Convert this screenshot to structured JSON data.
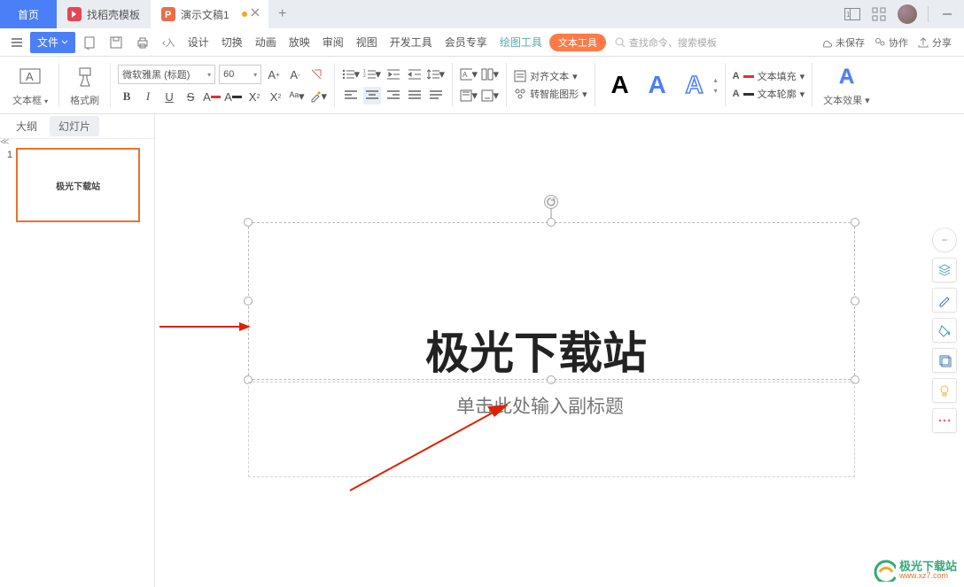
{
  "tabs": {
    "home": "首页",
    "docker": "找稻壳模板",
    "doc": "演示文稿1"
  },
  "menubar": {
    "menu_btn": "≡",
    "file": "文件",
    "items": [
      "设计",
      "切换",
      "动画",
      "放映",
      "审阅",
      "视图",
      "开发工具",
      "会员专享"
    ],
    "draw_tool": "绘图工具",
    "text_tool": "文本工具",
    "search_placeholder": "查找命令、搜索模板",
    "unsaved_icon": "",
    "unsaved": "未保存",
    "coop": "协作",
    "share": "分享"
  },
  "toolbar": {
    "textbox": "文本框",
    "format_painter": "格式刷",
    "font_name": "微软雅黑 (标题)",
    "font_size": "60",
    "align_text": "对齐文本",
    "smart_graphic": "转智能图形",
    "text_fill": "文本填充",
    "text_outline": "文本轮廓",
    "text_effect": "文本效果"
  },
  "sidepanel": {
    "tab_outline": "大纲",
    "tab_slides": "幻灯片",
    "slide_num": "1",
    "thumb_title": "极光下载站"
  },
  "slide": {
    "title": "极光下载站",
    "subtitle": "单击此处输入副标题"
  },
  "watermark": {
    "title": "极光下载站",
    "sub": "www.xz7.com"
  }
}
